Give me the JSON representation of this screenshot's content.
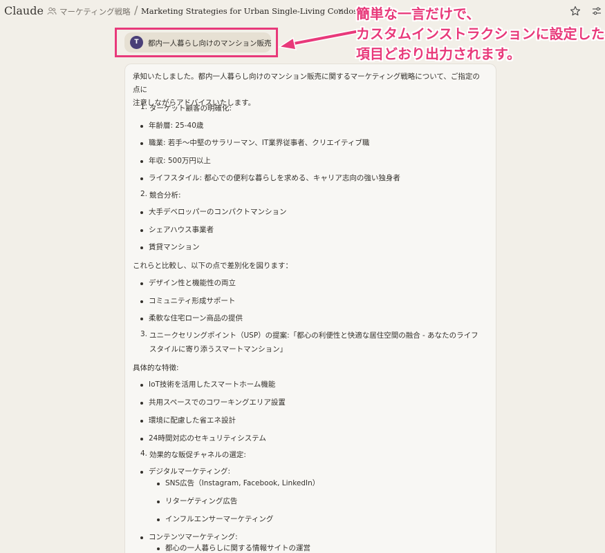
{
  "app": {
    "name": "Claude"
  },
  "header": {
    "project": "マーケティング戦略",
    "separator": "/",
    "title": "Marketing Strategies for Urban Single-Living Condos"
  },
  "user_message": {
    "avatar_letter": "T",
    "text": "都内一人暮らし向けのマンション販売"
  },
  "annotation": {
    "lines": [
      "簡単な一言だけで、",
      "カスタムインストラクションに設定した",
      "項目どおり出力されます。"
    ]
  },
  "response": {
    "intro_1": "承知いたしました。都内一人暮らし向けのマンション販売に関するマーケティング戦略について、ご指定の点に",
    "intro_2": "注意しながらアドバイスいたします。",
    "s1": {
      "num": "1.",
      "title": "ターゲット顧客の明確化:"
    },
    "s1_items": [
      "年齢層: 25-40歳",
      "職業: 若手～中堅のサラリーマン、IT業界従事者、クリエイティブ職",
      "年収: 500万円以上",
      "ライフスタイル: 都心での便利な暮らしを求める、キャリア志向の強い独身者"
    ],
    "s2": {
      "num": "2.",
      "title": "競合分析:"
    },
    "s2_items": [
      "大手デベロッパーのコンパクトマンション",
      "シェアハウス事業者",
      "賃貸マンション"
    ],
    "compare": "これらと比較し、以下の点で差別化を図ります：",
    "diff_items": [
      "デザイン性と機能性の両立",
      "コミュニティ形成サポート",
      "柔軟な住宅ローン商品の提供"
    ],
    "s3": {
      "num": "3.",
      "line1": "ユニークセリングポイント（USP）の提案:「都心の利便性と快適な居住空間の融合 - あなたのライフ",
      "line2": "スタイルに寄り添うスマートマンション」"
    },
    "features_label": "具体的な特徴:",
    "features": [
      "IoT技術を活用したスマートホーム機能",
      "共用スペースでのコワーキングエリア設置",
      "環境に配慮した省エネ設計",
      "24時間対応のセキュリティシステム"
    ],
    "s4": {
      "num": "4.",
      "title": "効果的な販促チャネルの選定:"
    },
    "s4_items": {
      "digital": "デジタルマーケティング:",
      "digital_sub": [
        "SNS広告（Instagram, Facebook, LinkedIn）",
        "リターゲティング広告",
        "インフルエンサーマーケティング"
      ],
      "content": "コンテンツマーケティング:",
      "content_sub": [
        "都心の一人暮らしに関する情報サイトの運営"
      ]
    }
  }
}
